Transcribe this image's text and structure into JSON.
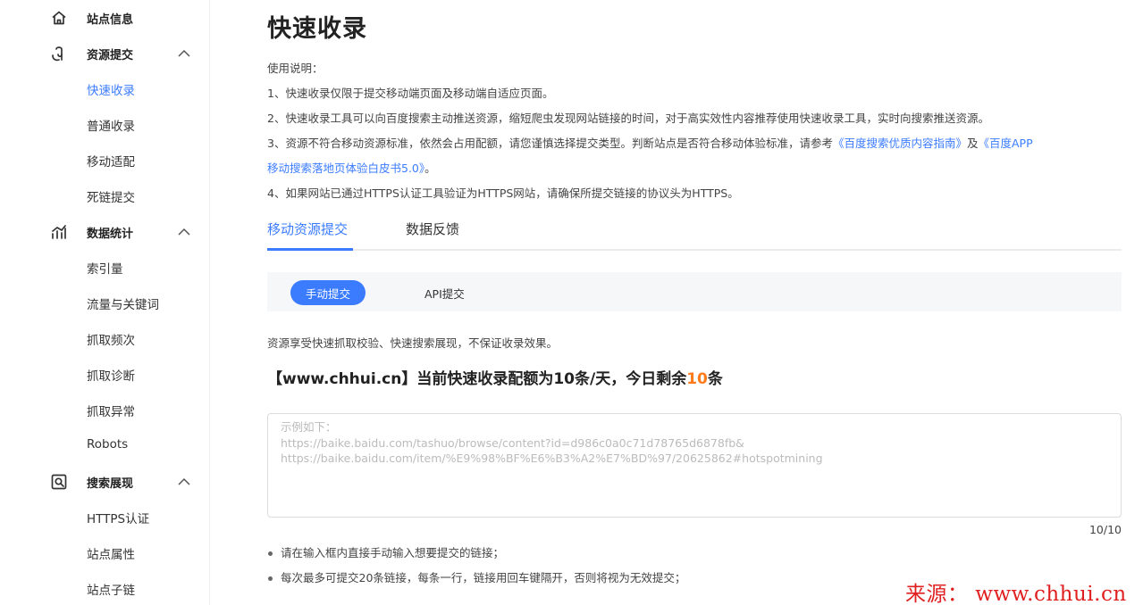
{
  "sidebar": {
    "groups": [
      {
        "label": "站点信息",
        "icon": "home-icon"
      },
      {
        "label": "资源提交",
        "icon": "submit-icon",
        "items": [
          "快速收录",
          "普通收录",
          "移动适配",
          "死链提交"
        ]
      },
      {
        "label": "数据统计",
        "icon": "stats-icon",
        "items": [
          "索引量",
          "流量与关键词",
          "抓取频次",
          "抓取诊断",
          "抓取异常",
          "Robots"
        ]
      },
      {
        "label": "搜索展现",
        "icon": "search-display-icon",
        "items": [
          "HTTPS认证",
          "站点属性",
          "站点子链"
        ]
      }
    ],
    "active_item": "快速收录"
  },
  "main": {
    "title": "快速收录",
    "instructions": {
      "heading": "使用说明：",
      "line1": "1、快速收录仅限于提交移动端页面及移动端自适应页面。",
      "line2": "2、快速收录工具可以向百度搜索主动推送资源，缩短爬虫发现网站链接的时间，对于高实效性内容推荐使用快速收录工具，实时向搜索推送资源。",
      "line3_prefix": "3、资源不符合移动资源标准，依然会占用配额，请您谨慎选择提交类型。判断站点是否符合移动体验标准，请参考",
      "line3_link1": "《百度搜索优质内容指南》",
      "line3_and": "及",
      "line3_link2a": "《百度APP",
      "line3_link2b": "移动搜索落地页体验白皮书5.0》",
      "line3_suffix": "。",
      "line4": "4、如果网站已通过HTTPS认证工具验证为HTTPS网站，请确保所提交链接的协议头为HTTPS。"
    },
    "tabs": [
      "移动资源提交",
      "数据反馈"
    ],
    "subtabs": [
      "手动提交",
      "API提交"
    ],
    "note": "资源享受快速抓取校验、快速搜索展现，不保证收录效果。",
    "quota": {
      "prefix": "【www.chhui.cn】当前快速收录配额为10条/天，今日剩余",
      "remaining": "10",
      "suffix": "条"
    },
    "textarea_placeholder": "示例如下：\nhttps://baike.baidu.com/tashuo/browse/content?id=d986c0a0c71d78765d6878fb&\nhttps://baike.baidu.com/item/%E9%98%BF%E6%B3%A2%E7%BD%97/20625862#hotspotmining",
    "counter": "10/10",
    "tips": [
      "请在输入框内直接手动输入想要提交的链接；",
      "每次最多可提交20条链接，每条一行，链接用回车键隔开，否则将视为无效提交；"
    ]
  },
  "watermark": "来源： www.chhui.cn",
  "colors": {
    "accent": "#3b7cff",
    "highlight": "#ff7a1a",
    "watermark": "#e02020"
  }
}
